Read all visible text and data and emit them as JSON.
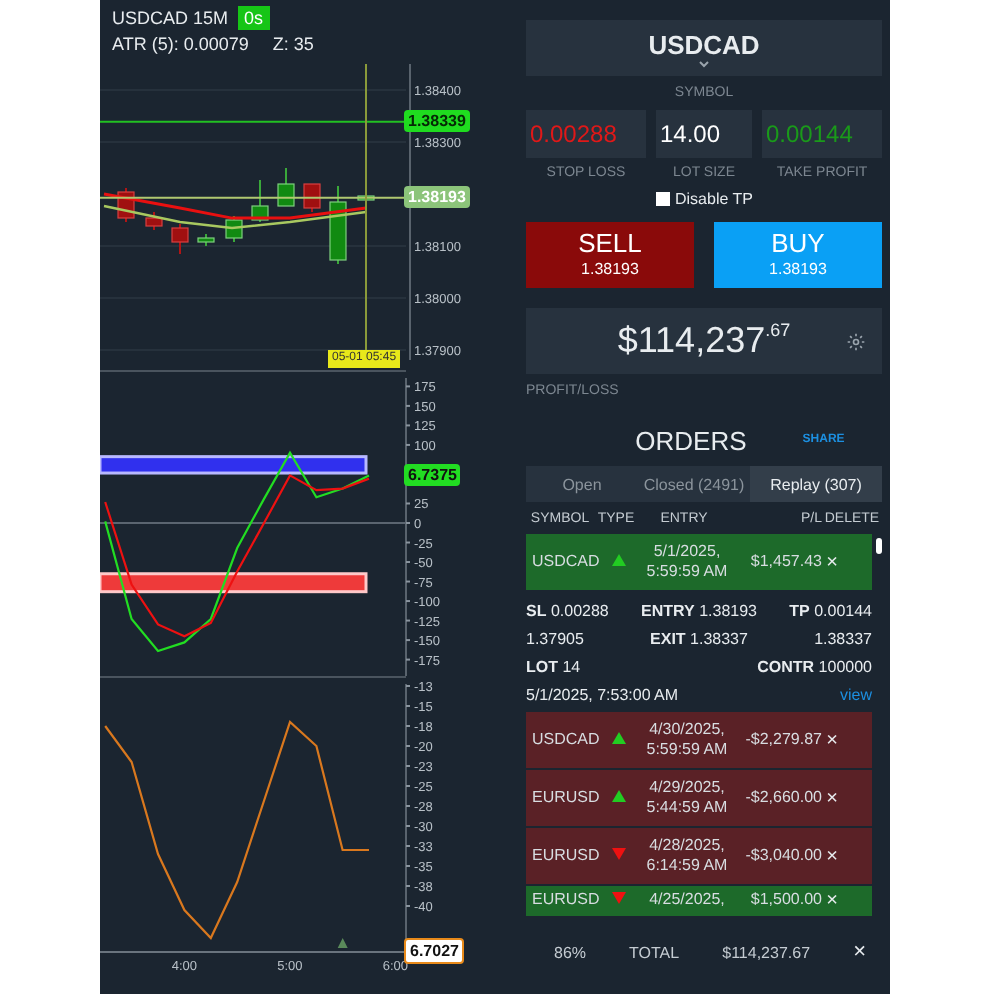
{
  "chart_header": {
    "symbol": "USDCAD 15M",
    "timer": "0s",
    "atr": "ATR (5): 0.00079",
    "z": "Z: 35"
  },
  "price_chart": {
    "axis_labels": [
      "1.38400",
      "1.38300",
      "1.38100",
      "1.38000",
      "1.37900"
    ],
    "line_tags": [
      {
        "kind": "target",
        "label": "1.38339"
      },
      {
        "kind": "current",
        "label": "1.38193"
      }
    ],
    "cursor_time": "05-01 05:45"
  },
  "oscillator": {
    "tag": "6.7375",
    "chart_data": {
      "type": "line",
      "x": [
        3.25,
        3.5,
        3.75,
        4,
        4.25,
        4.5,
        4.75,
        5,
        5.25,
        5.5,
        5.75
      ],
      "xlim": [
        3.2,
        6.1
      ],
      "ylim": [
        -196,
        196
      ],
      "yticks": [
        175,
        150,
        125,
        100,
        25,
        0,
        -25,
        -50,
        -75,
        -100,
        -125,
        -150,
        -175
      ],
      "series": [
        {
          "color": "#22dd22",
          "values": [
            2,
            -123,
            -164,
            -153,
            -123,
            -32,
            30,
            90,
            33,
            44,
            61
          ]
        },
        {
          "color": "#ee1111",
          "values": [
            27,
            -79,
            -130,
            -145,
            -128,
            -62,
            -1,
            61,
            42,
            44,
            57
          ]
        }
      ]
    }
  },
  "momentum": {
    "tag": "6.7027",
    "chart_data": {
      "type": "line",
      "x": [
        3.25,
        3.5,
        3.75,
        4,
        4.25,
        4.5,
        4.75,
        5,
        5.25,
        5.5,
        5.75
      ],
      "xlim": [
        3.2,
        6.1
      ],
      "ylim": [
        -45.75,
        -11.25
      ],
      "xticks": [
        {
          "value": 4,
          "label": "4:00"
        },
        {
          "value": 5,
          "label": "5:00"
        },
        {
          "value": 6,
          "label": "6:00"
        }
      ],
      "yticks": [
        {
          "value": -12.5,
          "label": "-13"
        },
        {
          "value": -15,
          "label": "-15"
        },
        {
          "value": -17.5,
          "label": "-18"
        },
        {
          "value": -20,
          "label": "-20"
        },
        {
          "value": -22.5,
          "label": "-23"
        },
        {
          "value": -25,
          "label": "-25"
        },
        {
          "value": -27.5,
          "label": "-28"
        },
        {
          "value": -30,
          "label": "-30"
        },
        {
          "value": -32.5,
          "label": "-33"
        },
        {
          "value": -35,
          "label": "-35"
        },
        {
          "value": -37.5,
          "label": "-38"
        },
        {
          "value": -40,
          "label": "-40"
        }
      ],
      "series": [
        {
          "color": "#d9781e",
          "values": [
            -17.5,
            -22,
            -33.5,
            -40.5,
            -44,
            -37,
            -27,
            -17,
            -20,
            -33,
            -33
          ]
        }
      ]
    }
  },
  "symbol": {
    "value": "USDCAD",
    "label": "SYMBOL"
  },
  "inputs": [
    {
      "kind": "loss",
      "value": "0.00288",
      "label": "STOP LOSS"
    },
    {
      "kind": "neutral",
      "value": "14.00",
      "label": "LOT SIZE"
    },
    {
      "kind": "profit",
      "value": "0.00144",
      "label": "TAKE PROFIT"
    }
  ],
  "disable_tp": {
    "label": "Disable TP",
    "checked": false
  },
  "sell": {
    "label": "SELL",
    "price": "1.38193"
  },
  "buy": {
    "label": "BUY",
    "price": "1.38193"
  },
  "pnl": {
    "whole": "$114,237",
    "cents": ".67",
    "label": "PROFIT/LOSS"
  },
  "orders": {
    "title": "ORDERS",
    "share": "SHARE",
    "tabs": [
      {
        "label": "Open",
        "selected": false
      },
      {
        "label": "Closed (2491)",
        "selected": false
      },
      {
        "label": "Replay (307)",
        "selected": true
      }
    ],
    "columns": [
      "SYMBOL",
      "TYPE",
      "ENTRY",
      "P/L",
      "DELETE"
    ],
    "rows": [
      {
        "symbol": "USDCAD",
        "kind": "buy",
        "color": "#1d6a2a",
        "entry": [
          "5/1/2025,",
          "5:59:59 AM"
        ],
        "pl": "$1,457.43",
        "delete": "×",
        "expanded": true,
        "details": [
          [
            "**SL** 0.00288",
            "**ENTRY** 1.38193",
            "**TP** 0.00144"
          ],
          [
            "1.37905",
            "**EXIT** 1.38337",
            "1.38337"
          ],
          [
            "**LOT** 14",
            "**CONTR** 100000"
          ]
        ],
        "closed_at": "5/1/2025, 7:53:00 AM",
        "link": "view"
      },
      {
        "symbol": "USDCAD",
        "kind": "buy",
        "color": "#5a2126",
        "entry": [
          "4/30/2025,",
          "5:59:59 AM"
        ],
        "pl": "-$2,279.87",
        "delete": "×",
        "expanded": false
      },
      {
        "symbol": "EURUSD",
        "kind": "buy",
        "color": "#5a2126",
        "entry": [
          "4/29/2025,",
          "5:44:59 AM"
        ],
        "pl": "-$2,660.00",
        "delete": "×",
        "expanded": false
      },
      {
        "symbol": "EURUSD",
        "kind": "sell",
        "color": "#5a2126",
        "entry": [
          "4/28/2025,",
          "6:14:59 AM"
        ],
        "pl": "-$3,040.00",
        "delete": "×",
        "expanded": false
      },
      {
        "symbol": "EURUSD",
        "kind": "sell",
        "color": "#1d6a2a",
        "entry": [
          "4/25/2025,"
        ],
        "pl": "$1,500.00",
        "delete": "×",
        "expanded": false
      }
    ]
  },
  "footer": {
    "percent": "86%",
    "total_label": "TOTAL",
    "total": "$114,237.67",
    "close": "×"
  }
}
